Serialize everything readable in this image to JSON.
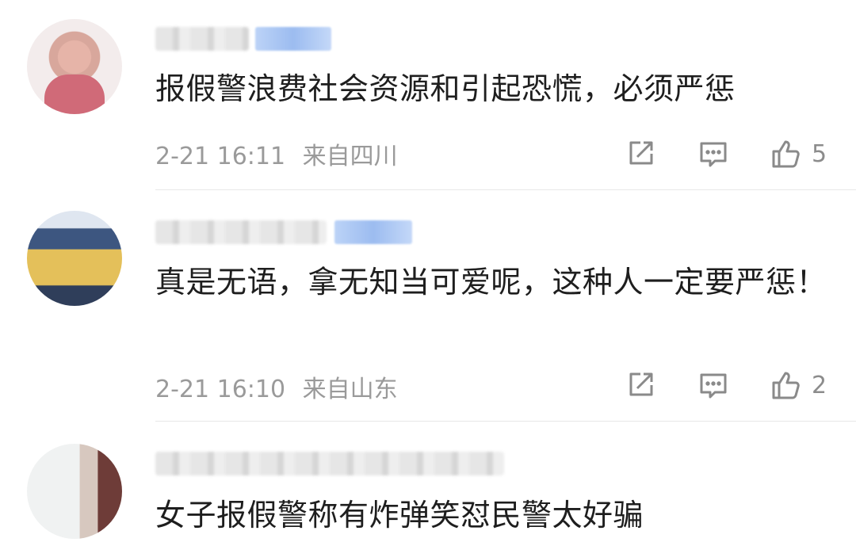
{
  "comments": [
    {
      "text": "报假警浪费社会资源和引起恐慌，必须严惩",
      "time": "2-21 16:11",
      "location": "来自四川",
      "likes": "5"
    },
    {
      "text": "真是无语，拿无知当可爱呢，这种人一定要严惩！",
      "time": "2-21 16:10",
      "location": "来自山东",
      "likes": "2"
    },
    {
      "text": "女子报假警称有炸弹笑怼民警太好骗"
    }
  ],
  "icons": {
    "share": "share-icon",
    "reply": "comment-icon",
    "like": "thumbs-up-icon"
  },
  "colors": {
    "meta": "#9a9a9a",
    "icon": "#8a8a8a",
    "divider": "#e8e8e8"
  }
}
